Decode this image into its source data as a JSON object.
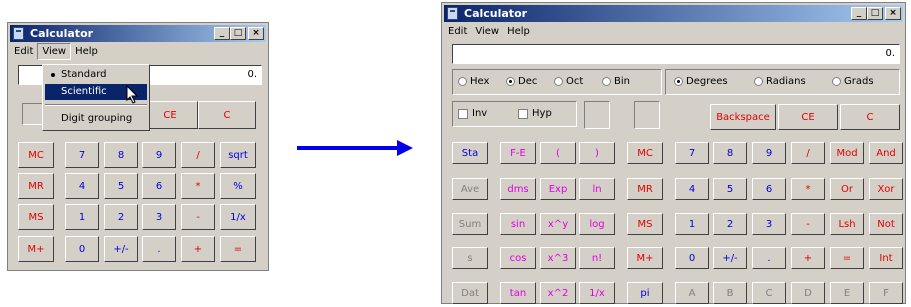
{
  "left": {
    "title": "Calculator",
    "menu": [
      "Edit",
      "View",
      "Help"
    ],
    "display": "0.",
    "mem_row": [
      "MC",
      "MR",
      "MS",
      "M+"
    ],
    "top_buttons": [
      "CE",
      "C"
    ],
    "keys": [
      [
        "7",
        "8",
        "9",
        "/",
        "sqrt"
      ],
      [
        "4",
        "5",
        "6",
        "*",
        "%"
      ],
      [
        "1",
        "2",
        "3",
        "-",
        "1/x"
      ],
      [
        "0",
        "+/-",
        ".",
        "+",
        "="
      ]
    ],
    "view_menu": {
      "standard": "Standard",
      "scientific": "Scientific",
      "digit_grouping": "Digit grouping"
    }
  },
  "right": {
    "title": "Calculator",
    "menu": [
      "Edit",
      "View",
      "Help"
    ],
    "display": "0.",
    "bases": [
      "Hex",
      "Dec",
      "Oct",
      "Bin"
    ],
    "base_selected": "Dec",
    "angles": [
      "Degrees",
      "Radians",
      "Grads"
    ],
    "angle_selected": "Degrees",
    "checks": [
      "Inv",
      "Hyp"
    ],
    "top_buttons": [
      "Backspace",
      "CE",
      "C"
    ],
    "stat_col": [
      "Sta",
      "Ave",
      "Sum",
      "s",
      "Dat"
    ],
    "fn_col1": [
      "F-E",
      "dms",
      "sin",
      "cos",
      "tan"
    ],
    "fn_col2": [
      "(",
      "Exp",
      "x^y",
      "x^3",
      "x^2"
    ],
    "fn_col3": [
      ")",
      "ln",
      "log",
      "n!",
      "1/x"
    ],
    "mem_col": [
      "MC",
      "MR",
      "MS",
      "M+",
      "pi"
    ],
    "digits": [
      [
        "7",
        "8",
        "9",
        "/",
        "Mod",
        "And"
      ],
      [
        "4",
        "5",
        "6",
        "*",
        "Or",
        "Xor"
      ],
      [
        "1",
        "2",
        "3",
        "-",
        "Lsh",
        "Not"
      ],
      [
        "0",
        "+/-",
        ".",
        "+",
        "=",
        "Int"
      ],
      [
        "A",
        "B",
        "C",
        "D",
        "E",
        "F"
      ]
    ]
  },
  "colors": {
    "title_start": "#0a246a",
    "title_end": "#a6caf0",
    "window": "#d4d0c8",
    "red": "#e00000",
    "blue": "#0000e0",
    "magenta": "#e000e0",
    "arrow": "#0000ee"
  }
}
